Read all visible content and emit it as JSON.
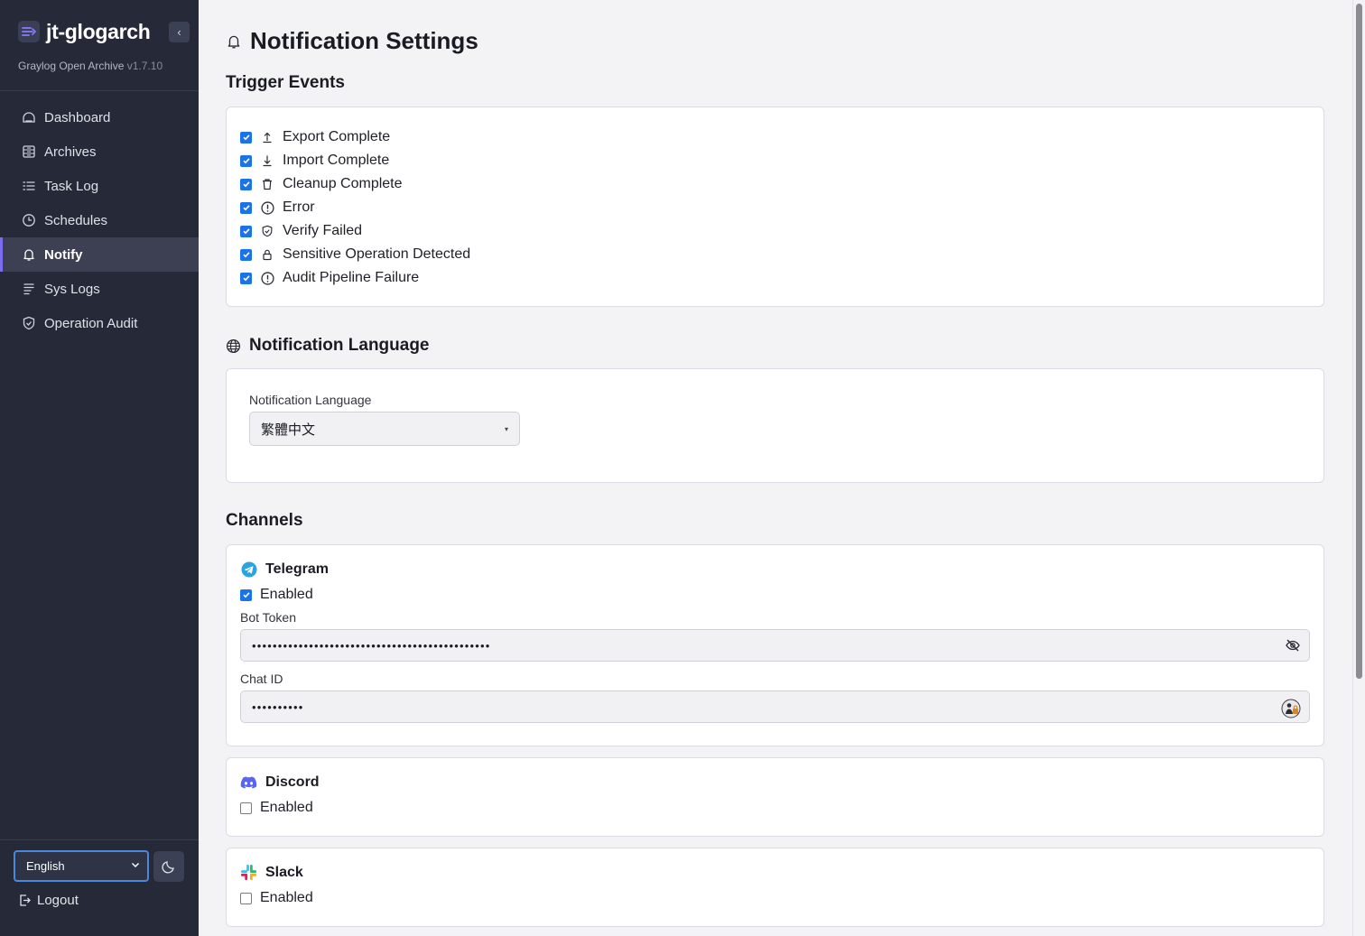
{
  "app": {
    "name": "jt-glogarch",
    "subtitle": "Graylog Open Archive",
    "version": "v1.7.10",
    "collapse_glyph": "‹"
  },
  "sidebar": {
    "items": [
      {
        "label": "Dashboard",
        "icon": "dashboard-icon"
      },
      {
        "label": "Archives",
        "icon": "archive-icon"
      },
      {
        "label": "Task Log",
        "icon": "list-icon"
      },
      {
        "label": "Schedules",
        "icon": "clock-icon"
      },
      {
        "label": "Notify",
        "icon": "bell-icon",
        "active": true
      },
      {
        "label": "Sys Logs",
        "icon": "lines-icon"
      },
      {
        "label": "Operation Audit",
        "icon": "shield-check-icon"
      }
    ],
    "language": "English",
    "logout_label": "Logout"
  },
  "page": {
    "title": "Notification Settings",
    "title_icon": "bell-icon"
  },
  "trigger_events": {
    "title": "Trigger Events",
    "items": [
      {
        "label": "Export Complete",
        "icon": "upload-icon",
        "checked": true
      },
      {
        "label": "Import Complete",
        "icon": "download-icon",
        "checked": true
      },
      {
        "label": "Cleanup Complete",
        "icon": "trash-icon",
        "checked": true
      },
      {
        "label": "Error",
        "icon": "alert-circle-icon",
        "checked": true
      },
      {
        "label": "Verify Failed",
        "icon": "shield-check-icon",
        "checked": true
      },
      {
        "label": "Sensitive Operation Detected",
        "icon": "lock-icon",
        "checked": true
      },
      {
        "label": "Audit Pipeline Failure",
        "icon": "alert-circle-icon",
        "checked": true
      }
    ]
  },
  "notification_language": {
    "title": "Notification Language",
    "field_label": "Notification Language",
    "selected": "繁體中文"
  },
  "channels": {
    "title": "Channels",
    "enabled_label": "Enabled",
    "telegram": {
      "name": "Telegram",
      "enabled": true,
      "bot_token_label": "Bot Token",
      "bot_token_value": "••••••••••••••••••••••••••••••••••••••••••••••",
      "chat_id_label": "Chat ID",
      "chat_id_value": "••••••••••"
    },
    "discord": {
      "name": "Discord",
      "enabled": false
    },
    "slack": {
      "name": "Slack",
      "enabled": false
    }
  },
  "colors": {
    "sidebar_bg": "#262937",
    "accent": "#7c6cf0",
    "checkbox": "#1a73e8",
    "telegram": "#2aa3e0",
    "discord": "#5865f2"
  }
}
